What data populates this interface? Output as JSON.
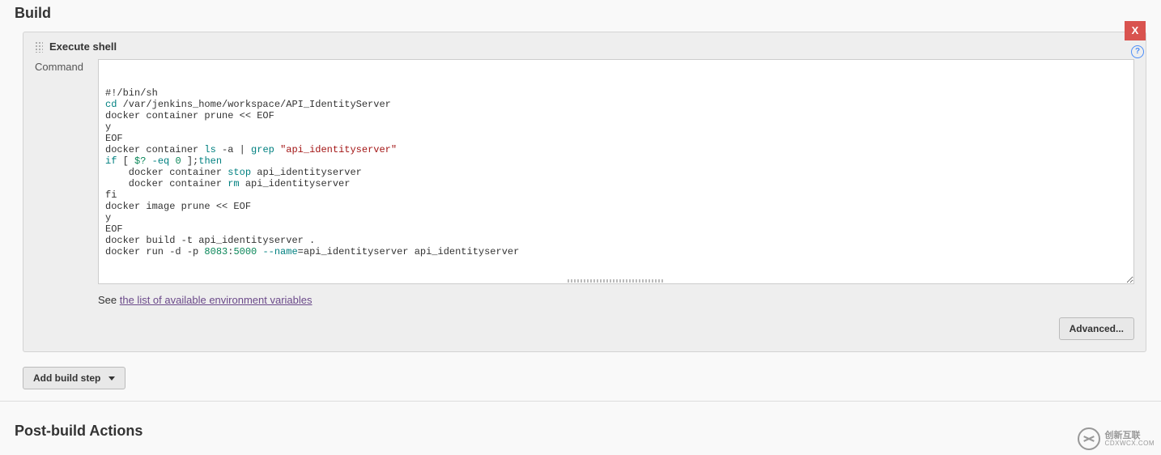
{
  "sections": {
    "build_title": "Build",
    "post_build_title": "Post-build Actions"
  },
  "build_step": {
    "type_label": "Execute shell",
    "field_label": "Command",
    "delete_label": "X",
    "help_tooltip": "Help",
    "env_help_prefix": "See ",
    "env_help_link": "the list of available environment variables",
    "advanced_label": "Advanced...",
    "command_lines": [
      {
        "t": "plain",
        "v": "#!/bin/sh"
      },
      {
        "t": "cd",
        "v": "cd /var/jenkins_home/workspace/API_IdentityServer"
      },
      {
        "t": "plain",
        "v": "docker container prune << EOF"
      },
      {
        "t": "plain",
        "v": "y"
      },
      {
        "t": "plain",
        "v": "EOF"
      },
      {
        "t": "grep",
        "v": "docker container ls -a | grep \"api_identityserver\""
      },
      {
        "t": "if",
        "v": "if [ $? -eq 0 ];then"
      },
      {
        "t": "stop",
        "v": "    docker container stop api_identityserver"
      },
      {
        "t": "rm",
        "v": "    docker container rm api_identityserver"
      },
      {
        "t": "plain",
        "v": "fi"
      },
      {
        "t": "plain",
        "v": "docker image prune << EOF"
      },
      {
        "t": "plain",
        "v": "y"
      },
      {
        "t": "plain",
        "v": "EOF"
      },
      {
        "t": "plain",
        "v": "docker build -t api_identityserver ."
      },
      {
        "t": "run",
        "v": "docker run -d -p 8083:5000 --name=api_identityserver api_identityserver"
      }
    ]
  },
  "buttons": {
    "add_build_step": "Add build step"
  },
  "watermark": {
    "cn": "创新互联",
    "en": "CDXWCX.COM"
  }
}
